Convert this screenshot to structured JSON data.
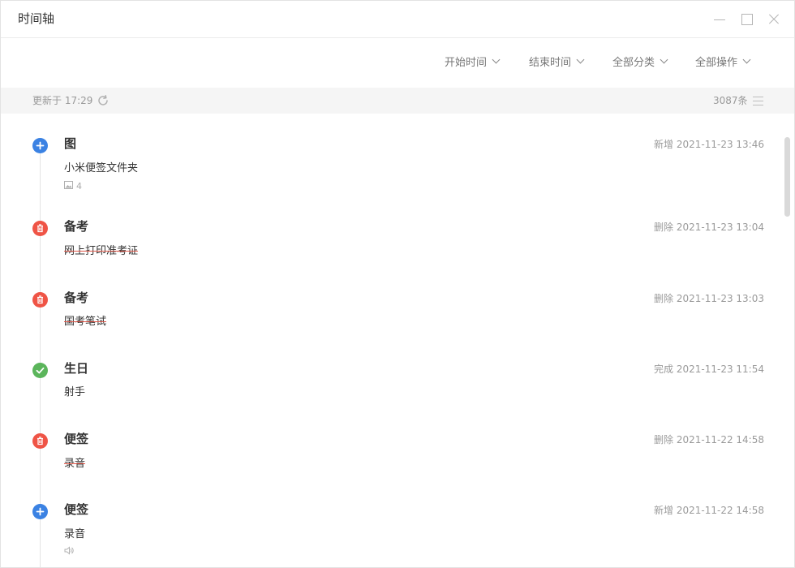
{
  "window": {
    "title": "时间轴"
  },
  "filters": [
    {
      "label": "开始时间"
    },
    {
      "label": "结束时间"
    },
    {
      "label": "全部分类"
    },
    {
      "label": "全部操作"
    }
  ],
  "status": {
    "updated": "更新于 17:29",
    "count": "3087条"
  },
  "entries": [
    {
      "category": "图",
      "action": "新增",
      "time": "2021-11-23 13:46",
      "content": "小米便签文件夹",
      "attachment": "4",
      "attachment_icon": "image-icon",
      "type": "add",
      "deleted": false
    },
    {
      "category": "备考",
      "action": "删除",
      "time": "2021-11-23 13:04",
      "content": "网上打印准考证",
      "type": "delete",
      "deleted": true
    },
    {
      "category": "备考",
      "action": "删除",
      "time": "2021-11-23 13:03",
      "content": "国考笔试",
      "type": "delete",
      "deleted": true
    },
    {
      "category": "生日",
      "action": "完成",
      "time": "2021-11-23 11:54",
      "content": "射手",
      "type": "complete",
      "deleted": false
    },
    {
      "category": "便签",
      "action": "删除",
      "time": "2021-11-22 14:58",
      "content": "录音",
      "type": "delete",
      "deleted": true
    },
    {
      "category": "便签",
      "action": "新增",
      "time": "2021-11-22 14:58",
      "content": "录音",
      "attachment_icon": "audio-icon",
      "type": "add",
      "deleted": false
    }
  ],
  "colors": {
    "add": "#3b82e3",
    "delete": "#ef5446",
    "complete": "#5bb55b",
    "status_bg": "#f5f5f5"
  }
}
